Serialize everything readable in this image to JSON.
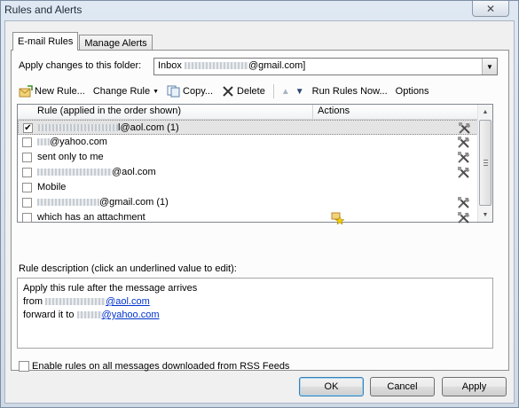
{
  "window": {
    "title": "Rules and Alerts",
    "close_symbol": "✕"
  },
  "tabs": [
    {
      "label": "E-mail Rules",
      "active": true
    },
    {
      "label": "Manage Alerts",
      "active": false
    }
  ],
  "folder": {
    "label": "Apply changes to this folder:",
    "value_prefix": "Inbox ",
    "value_suffix": "@gmail.com]"
  },
  "toolbar": {
    "new_rule": "New Rule...",
    "change_rule": "Change Rule",
    "copy": "Copy...",
    "delete": "Delete",
    "run_rules": "Run Rules Now...",
    "options": "Options"
  },
  "rules_table": {
    "col_rule": "Rule (applied in the order shown)",
    "col_actions": "Actions",
    "rows": [
      {
        "suffix": "l@aol.com (1)",
        "checked": true,
        "selected": true,
        "action_icon": "rule-tools-icon"
      },
      {
        "suffix": "@yahoo.com",
        "checked": false,
        "selected": false,
        "action_icon": "rule-tools-icon"
      },
      {
        "text": "sent only to me",
        "checked": false,
        "selected": false,
        "action_icon": "rule-tools-icon"
      },
      {
        "suffix": "@aol.com",
        "checked": false,
        "selected": false,
        "action_icon": "rule-tools-icon"
      },
      {
        "text": "Mobile",
        "checked": false,
        "selected": false,
        "action_icon": ""
      },
      {
        "suffix": "@gmail.com (1)",
        "checked": false,
        "selected": false,
        "action_icon": "rule-tools-icon"
      },
      {
        "text": "which has an attachment",
        "checked": false,
        "selected": false,
        "action_icon": "rule-tools-icon"
      }
    ]
  },
  "description": {
    "label": "Rule description (click an underlined value to edit):",
    "line1": "Apply this rule after the message arrives",
    "line2_prefix": "from ",
    "line2_link_suffix": "@aol.com",
    "line3_prefix": "forward it to ",
    "line3_link_suffix": "@yahoo.com"
  },
  "rss_checkbox": {
    "label": "Enable rules on all messages downloaded from RSS Feeds",
    "checked": false
  },
  "buttons": {
    "ok": "OK",
    "cancel": "Cancel",
    "apply": "Apply"
  }
}
